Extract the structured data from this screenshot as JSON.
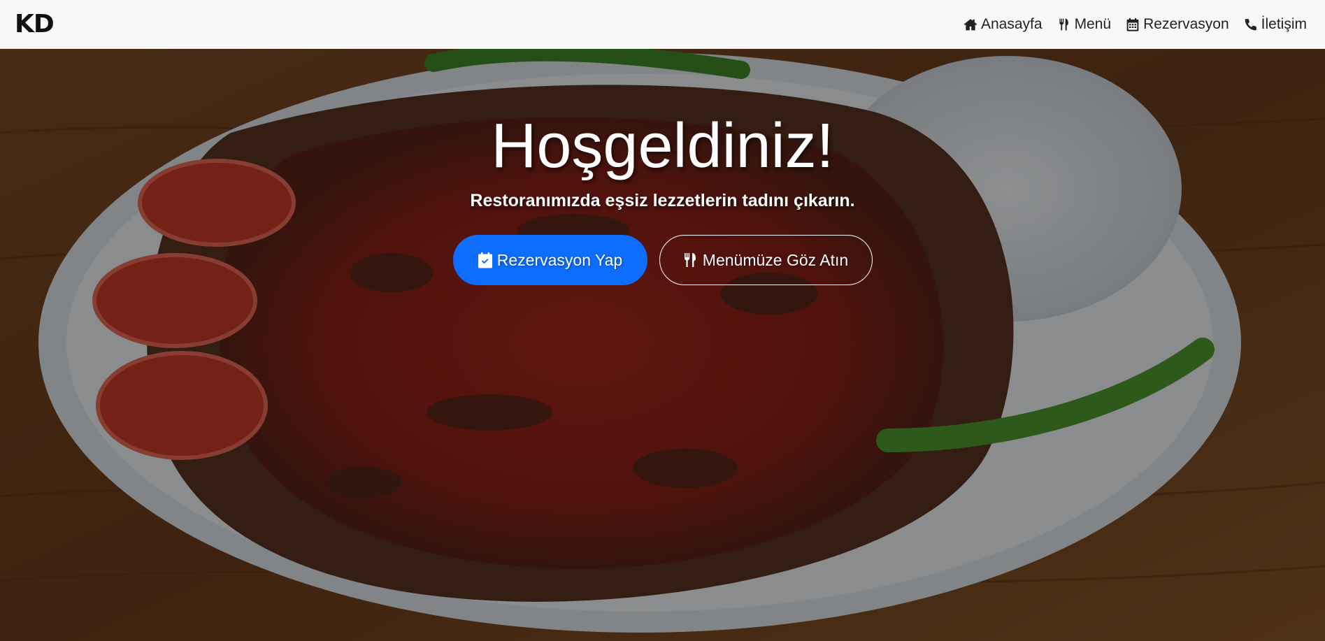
{
  "brand": {
    "text": "KD"
  },
  "nav": {
    "items": [
      {
        "label": "Anasayfa",
        "icon": "home-icon"
      },
      {
        "label": "Menü",
        "icon": "utensils-icon"
      },
      {
        "label": "Rezervasyon",
        "icon": "calendar-icon"
      },
      {
        "label": "İletişim",
        "icon": "phone-icon"
      }
    ]
  },
  "hero": {
    "title": "Hoşgeldiniz!",
    "subtitle": "Restoranımızda eşsiz lezzetlerin tadını çıkarın.",
    "primary_button": {
      "label": "Rezervasyon Yap",
      "icon": "calendar-check-icon"
    },
    "secondary_button": {
      "label": "Menümüze Göz Atın",
      "icon": "utensils-icon"
    },
    "background_image": "food-plate-photo"
  },
  "colors": {
    "navbar_bg": "#f8f9fa",
    "primary": "#0d6efd",
    "hero_text": "#ffffff"
  }
}
